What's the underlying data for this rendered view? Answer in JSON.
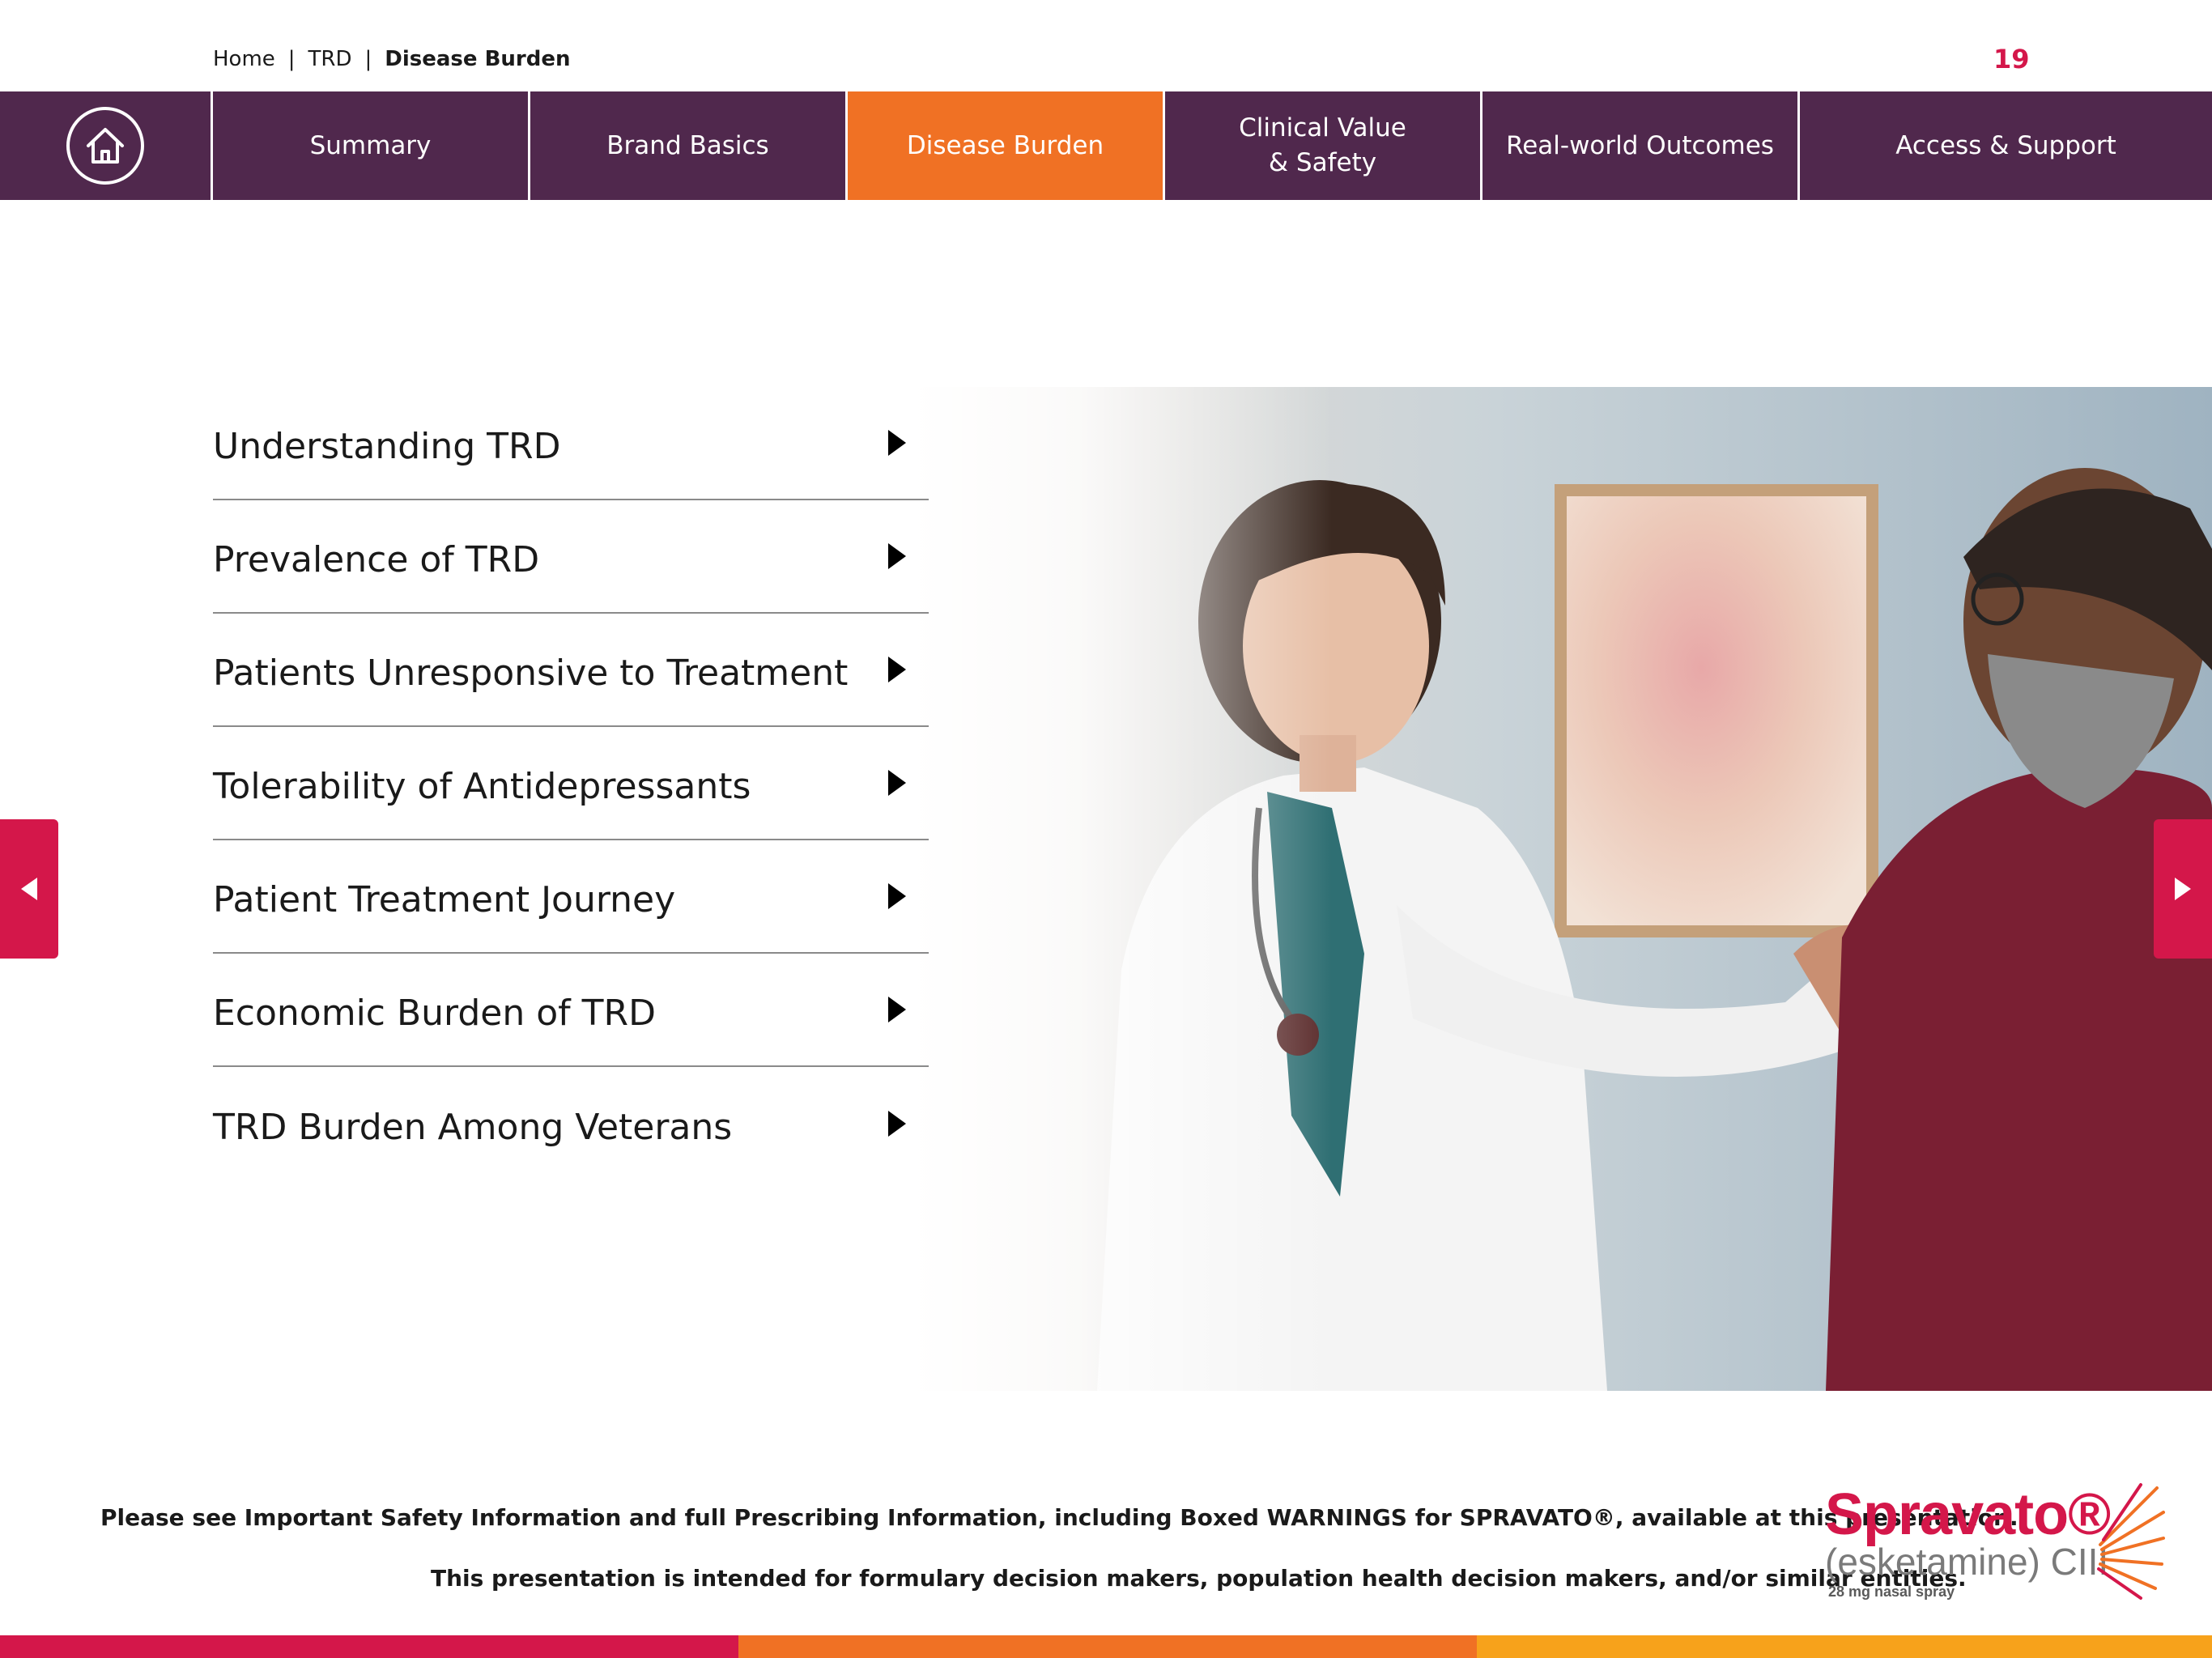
{
  "breadcrumb": {
    "home": "Home",
    "sep": "|",
    "section": "TRD",
    "current": "Disease Burden"
  },
  "page_number": "19",
  "nav": {
    "home_icon": "house-icon",
    "tabs": [
      {
        "label": "Summary"
      },
      {
        "label": "Brand Basics"
      },
      {
        "label": "Disease Burden",
        "active": true
      },
      {
        "label": "Clinical Value\n& Safety"
      },
      {
        "label": "Real-world Outcomes"
      },
      {
        "label": "Access & Support"
      }
    ]
  },
  "menu": {
    "items": [
      {
        "label": "Understanding TRD"
      },
      {
        "label": "Prevalence of TRD"
      },
      {
        "label": "Patients Unresponsive to Treatment"
      },
      {
        "label": "Tolerability of Antidepressants"
      },
      {
        "label": "Patient Treatment Journey"
      },
      {
        "label": "Economic Burden of TRD"
      },
      {
        "label": "TRD Burden Among Veterans"
      }
    ],
    "arrow_icon": "triangle-right-icon"
  },
  "footer": {
    "line1": "Please see Important Safety Information and full Prescribing Information, including Boxed WARNINGS for SPRAVATO®, available at this presentation.",
    "line2": "This presentation is intended for formulary decision makers, population health decision makers, and/or similar entities."
  },
  "logo": {
    "name": "Spravato®",
    "generic": "(esketamine) CIII",
    "dose": "28 mg nasal spray"
  },
  "colors": {
    "nav_bg": "#50284d",
    "active_tab": "#f07124",
    "accent": "#d4174a",
    "stripe": [
      "#d4174a",
      "#f07124",
      "#f7a21b"
    ]
  }
}
